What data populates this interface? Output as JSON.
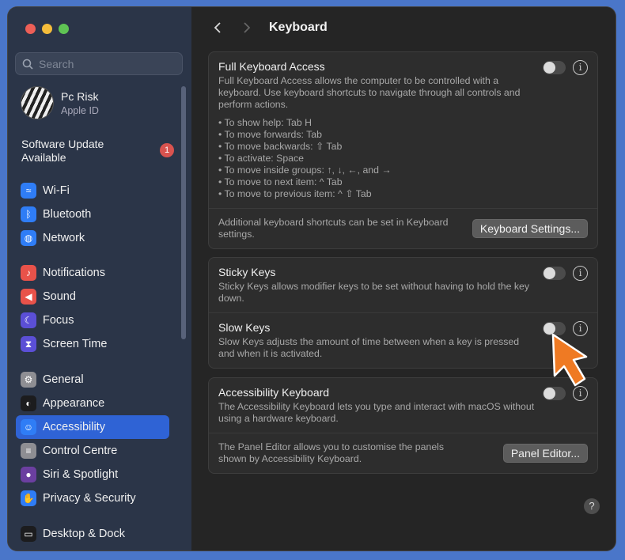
{
  "sidebar": {
    "search_placeholder": "Search",
    "profile": {
      "name": "Pc Risk",
      "subtitle": "Apple ID"
    },
    "update": {
      "label": "Software Update Available",
      "count": "1"
    },
    "groups": [
      [
        {
          "label": "Wi-Fi",
          "icon": "wifi-icon",
          "color": "#2f7df6"
        },
        {
          "label": "Bluetooth",
          "icon": "bluetooth-icon",
          "color": "#2f7df6"
        },
        {
          "label": "Network",
          "icon": "globe-icon",
          "color": "#2f7df6"
        }
      ],
      [
        {
          "label": "Notifications",
          "icon": "bell-icon",
          "color": "#e8524a"
        },
        {
          "label": "Sound",
          "icon": "speaker-icon",
          "color": "#e8524a"
        },
        {
          "label": "Focus",
          "icon": "moon-icon",
          "color": "#5b4fd6"
        },
        {
          "label": "Screen Time",
          "icon": "hourglass-icon",
          "color": "#5b4fd6"
        }
      ],
      [
        {
          "label": "General",
          "icon": "gear-icon",
          "color": "#8e8e93"
        },
        {
          "label": "Appearance",
          "icon": "appearance-icon",
          "color": "#1c1c1e"
        },
        {
          "label": "Accessibility",
          "icon": "accessibility-icon",
          "color": "#2f7df6",
          "active": true
        },
        {
          "label": "Control Centre",
          "icon": "control-centre-icon",
          "color": "#8e8e93"
        },
        {
          "label": "Siri & Spotlight",
          "icon": "siri-icon",
          "color": "#6b3fa0"
        },
        {
          "label": "Privacy & Security",
          "icon": "hand-icon",
          "color": "#2f7df6"
        }
      ],
      [
        {
          "label": "Desktop & Dock",
          "icon": "dock-icon",
          "color": "#1c1c1e"
        }
      ]
    ]
  },
  "main": {
    "title": "Keyboard",
    "full_keyboard_access": {
      "title": "Full Keyboard Access",
      "desc": "Full Keyboard Access allows the computer to be controlled with a keyboard. Use keyboard shortcuts to navigate through all controls and perform actions.",
      "bullets": [
        "• To show help: Tab H",
        "• To move forwards: Tab",
        "• To move backwards: ⇧ Tab",
        "• To activate: Space",
        "• To move inside groups: ↑, ↓, ←, and →",
        "• To move to next item: ^ Tab",
        "• To move to previous item: ^ ⇧ Tab"
      ],
      "footer": "Additional keyboard shortcuts can be set in Keyboard settings.",
      "button": "Keyboard Settings..."
    },
    "sticky_keys": {
      "title": "Sticky Keys",
      "desc": "Sticky Keys allows modifier keys to be set without having to hold the key down."
    },
    "slow_keys": {
      "title": "Slow Keys",
      "desc": "Slow Keys adjusts the amount of time between when a key is pressed and when it is activated."
    },
    "accessibility_keyboard": {
      "title": "Accessibility Keyboard",
      "desc": "The Accessibility Keyboard lets you type and interact with macOS without using a hardware keyboard.",
      "footer": "The Panel Editor allows you to customise the panels shown by Accessibility Keyboard.",
      "button": "Panel Editor..."
    },
    "help_label": "?"
  }
}
